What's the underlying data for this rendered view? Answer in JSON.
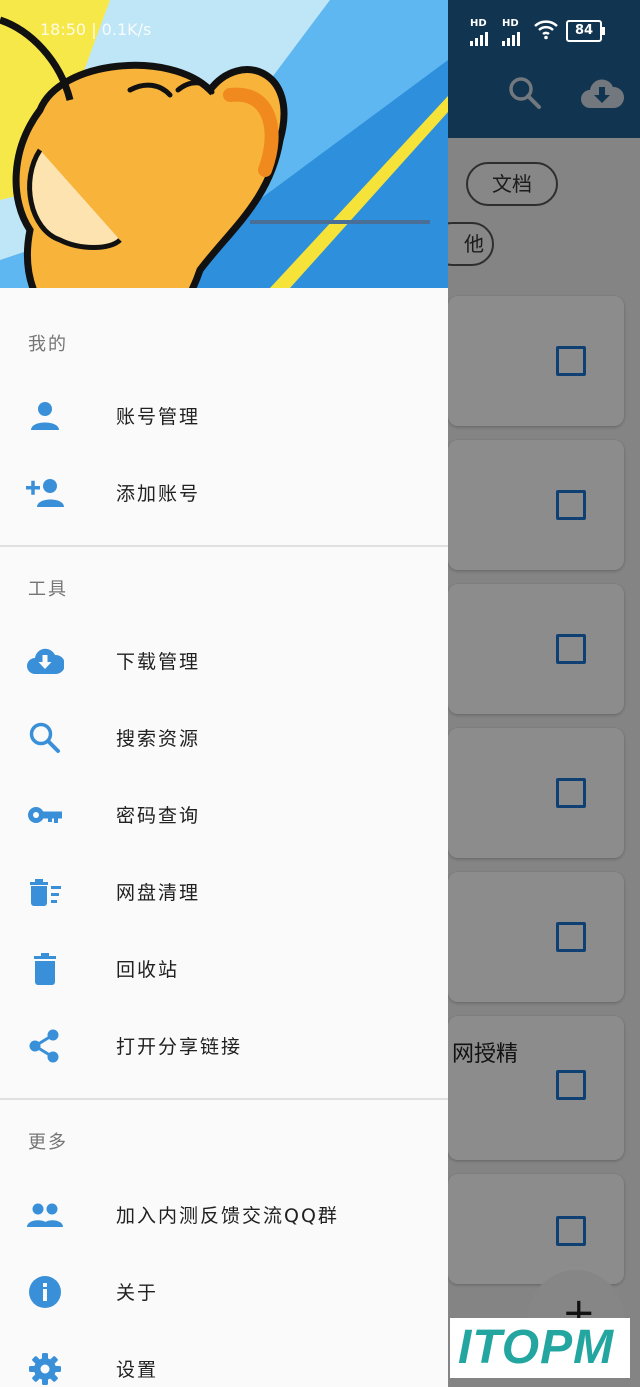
{
  "status_bar": {
    "time": "18:50 | 0.1K/s",
    "signal1": "HD",
    "signal2": "HD",
    "battery": "84"
  },
  "background": {
    "chips": [
      "文档",
      "他"
    ],
    "card_text": "网授精",
    "fab_symbol": "+"
  },
  "drawer": {
    "sections": [
      {
        "title": "我的",
        "items": [
          {
            "label": "账号管理",
            "icon": "account-icon"
          },
          {
            "label": "添加账号",
            "icon": "add-account-icon"
          }
        ]
      },
      {
        "title": "工具",
        "items": [
          {
            "label": "下载管理",
            "icon": "cloud-download-icon"
          },
          {
            "label": "搜索资源",
            "icon": "search-icon"
          },
          {
            "label": "密码查询",
            "icon": "key-icon"
          },
          {
            "label": "网盘清理",
            "icon": "delete-sweep-icon"
          },
          {
            "label": "回收站",
            "icon": "trash-icon"
          },
          {
            "label": "打开分享链接",
            "icon": "share-icon"
          }
        ]
      },
      {
        "title": "更多",
        "items": [
          {
            "label": "加入内测反馈交流QQ群",
            "icon": "group-icon"
          },
          {
            "label": "关于",
            "icon": "info-icon"
          },
          {
            "label": "设置",
            "icon": "gear-icon"
          }
        ]
      }
    ]
  },
  "watermark": "ITOPM",
  "colors": {
    "accent": "#3a90d8",
    "appbar": "#1f5f93",
    "checkbox": "#1c76d2"
  }
}
